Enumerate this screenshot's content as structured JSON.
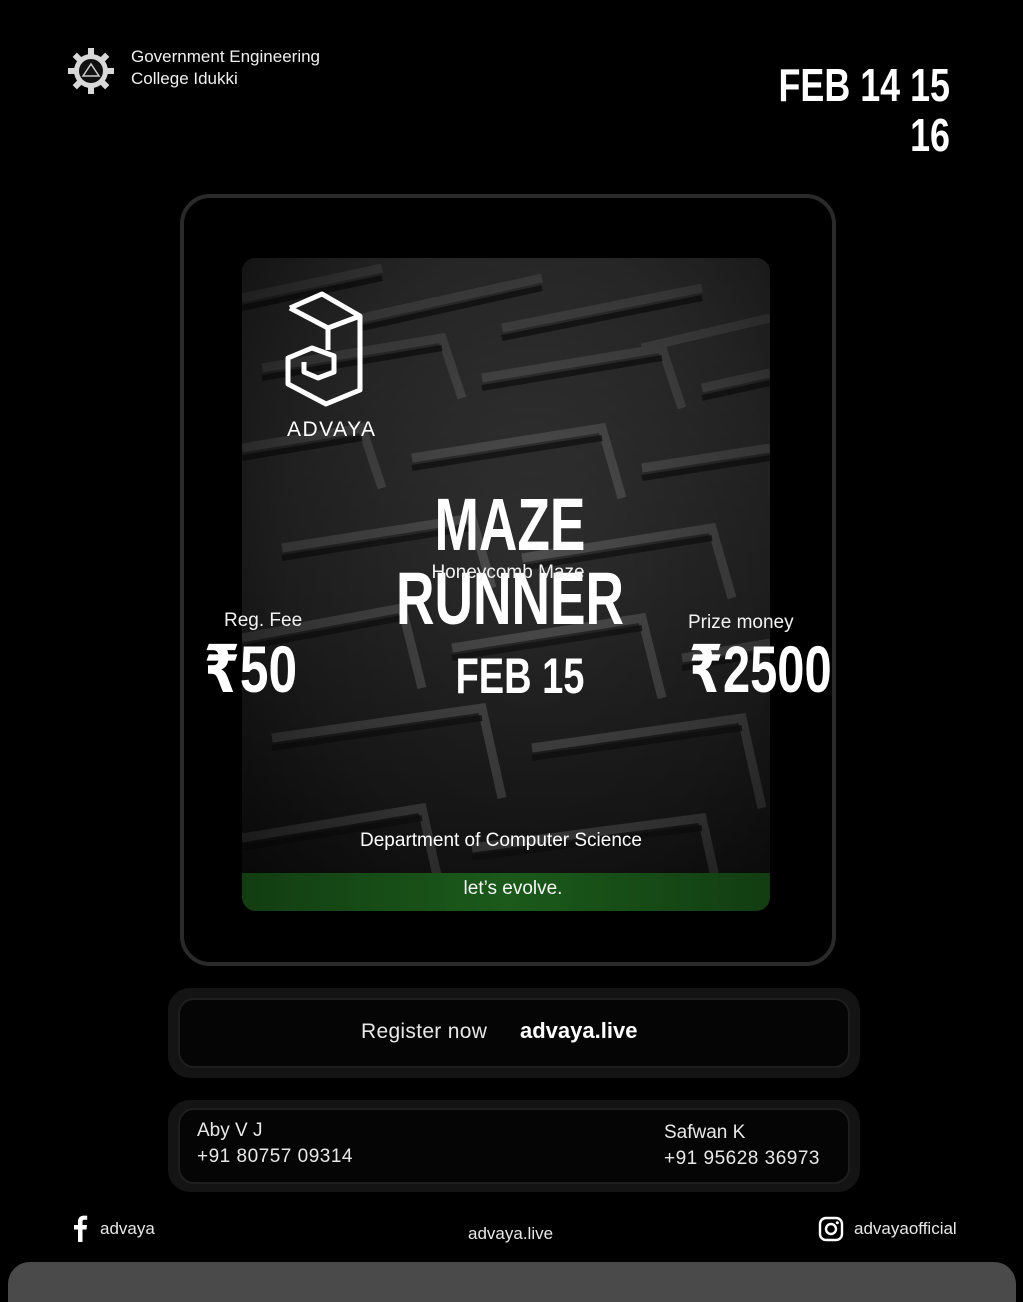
{
  "header": {
    "college_name_line1": "Government Engineering",
    "college_name_line2": "College Idukki",
    "dates": "FEB 14 15 16"
  },
  "poster": {
    "brand": "ADVAYA",
    "title": "MAZE RUNNER",
    "subtitle": "Honeycomb Maze",
    "fee_label": "Reg. Fee",
    "fee_value": "₹50",
    "event_date": "FEB 15",
    "prize_label": "Prize money",
    "prize_value": "₹2500",
    "department": "Department of Computer Science",
    "tagline": "let’s evolve."
  },
  "register": {
    "text": "Register now",
    "link": "advaya.live"
  },
  "contacts": [
    {
      "name": "Aby V J",
      "phone": "+91 80757 09314"
    },
    {
      "name": "Safwan K",
      "phone": "+91 95628 36973"
    }
  ],
  "footer": {
    "facebook_handle": "advaya",
    "website": "advaya.live",
    "instagram_handle": "advayaofficial"
  },
  "colors": {
    "background": "#000000",
    "tagline_band": "#1b5a1b",
    "frame_border": "#2a2a2a"
  },
  "icons": [
    "college-gear-logo-icon",
    "advaya-logo-icon",
    "facebook-icon",
    "instagram-icon"
  ]
}
